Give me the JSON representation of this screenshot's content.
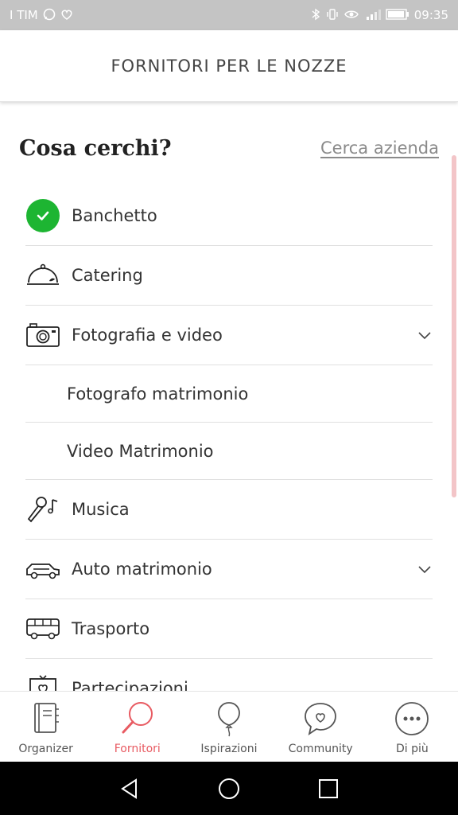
{
  "status_bar": {
    "carrier": "I TIM",
    "time": "09:35",
    "bg_color": "#c4c4c4"
  },
  "header": {
    "title": "FORNITORI PER LE NOZZE"
  },
  "search": {
    "title": "Cosa cerchi?",
    "link": "Cerca azienda"
  },
  "categories": [
    {
      "label": "Banchetto",
      "icon": "check-icon",
      "selected": true,
      "expandable": false
    },
    {
      "label": "Catering",
      "icon": "cloche-icon",
      "expandable": false
    },
    {
      "label": "Fotografia e video",
      "icon": "camera-icon",
      "expandable": true
    },
    {
      "label": "Fotografo matrimonio",
      "sub": true
    },
    {
      "label": "Video Matrimonio",
      "sub": true
    },
    {
      "label": "Musica",
      "icon": "microphone-music-icon",
      "expandable": false
    },
    {
      "label": "Auto matrimonio",
      "icon": "car-icon",
      "expandable": true
    },
    {
      "label": "Trasporto",
      "icon": "bus-icon",
      "expandable": false
    },
    {
      "label": "Partecipazioni",
      "icon": "invitation-icon",
      "expandable": false
    }
  ],
  "bottom_nav": [
    {
      "label": "Organizer",
      "icon": "planner-icon",
      "active": false
    },
    {
      "label": "Fornitori",
      "icon": "search-icon",
      "active": true
    },
    {
      "label": "Ispirazioni",
      "icon": "balloon-icon",
      "active": false
    },
    {
      "label": "Community",
      "icon": "chat-heart-icon",
      "active": false
    },
    {
      "label": "Di più",
      "icon": "more-icon",
      "active": false
    }
  ],
  "colors": {
    "accent": "#e85b62",
    "check_green": "#1db532",
    "scrollbar": "#f3c5c8"
  }
}
